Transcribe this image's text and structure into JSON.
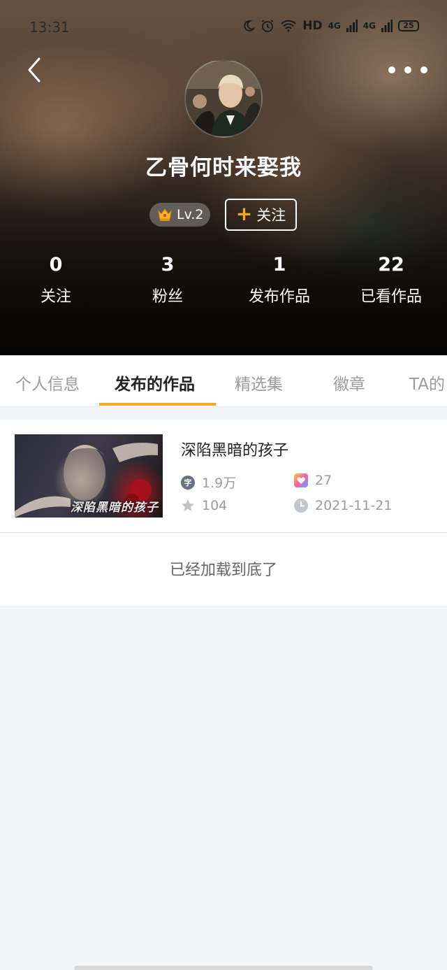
{
  "status_bar": {
    "time": "13:31",
    "network_label": "HD",
    "signal_1_label": "4G",
    "signal_2_label": "4G",
    "battery": "25"
  },
  "profile": {
    "username": "乙骨何时来娶我",
    "level": "Lv.2",
    "follow_label": "关注",
    "stats": [
      {
        "value": "0",
        "label": "关注"
      },
      {
        "value": "3",
        "label": "粉丝"
      },
      {
        "value": "1",
        "label": "发布作品"
      },
      {
        "value": "22",
        "label": "已看作品"
      }
    ]
  },
  "tabs": [
    {
      "label": "个人信息",
      "active": false
    },
    {
      "label": "发布的作品",
      "active": true
    },
    {
      "label": "精选集",
      "active": false
    },
    {
      "label": "徽章",
      "active": false
    },
    {
      "label": "TA的",
      "active": false
    }
  ],
  "works": [
    {
      "cover_text": "深陷黑暗的孩子",
      "title": "深陷黑暗的孩子",
      "word_count": "1.9万",
      "likes": "27",
      "stars": "104",
      "date": "2021-11-21",
      "word_icon_char": "字"
    }
  ],
  "list_end_text": "已经加载到底了",
  "colors": {
    "accent": "#f6a623",
    "tab_inactive": "#9b9b9b",
    "page_bg": "#f4f5f7"
  },
  "icons": [
    "back-arrow-icon",
    "more-icon",
    "crown-level-icon",
    "word-count-icon",
    "heart-icon",
    "star-icon",
    "clock-icon"
  ]
}
